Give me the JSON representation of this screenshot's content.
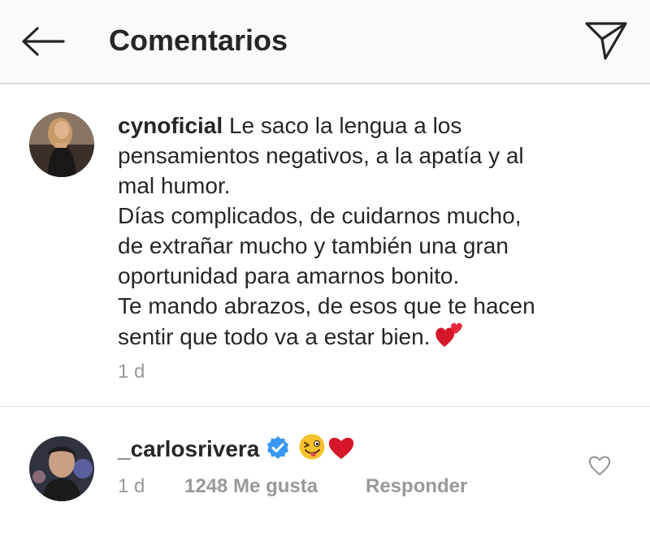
{
  "header": {
    "title": "Comentarios",
    "back_icon": "arrow-left-icon",
    "share_icon": "paper-plane-icon"
  },
  "comments": [
    {
      "username": "cynoficial",
      "caption_lines": [
        "Le saco la lengua a los",
        "pensamientos negativos, a la apatía y al",
        "mal humor.",
        "Días complicados, de cuidarnos mucho,",
        "de extrañar mucho y también una gran",
        "oportunidad para amarnos bonito.",
        "Te mando abrazos, de esos que te hacen",
        "sentir que todo va a estar bien."
      ],
      "emoji": "two-hearts-icon",
      "time": "1 d"
    },
    {
      "username": "_carlosrivera",
      "verified": true,
      "emojis": [
        "winking-face-tongue-icon",
        "red-heart-icon"
      ],
      "time": "1 d",
      "likes": "1248 Me gusta",
      "reply": "Responder"
    }
  ],
  "colors": {
    "text": "#262626",
    "meta": "#999999",
    "verified": "#3897f0",
    "heart": "#d6172a",
    "header_bg": "#fafafa"
  }
}
